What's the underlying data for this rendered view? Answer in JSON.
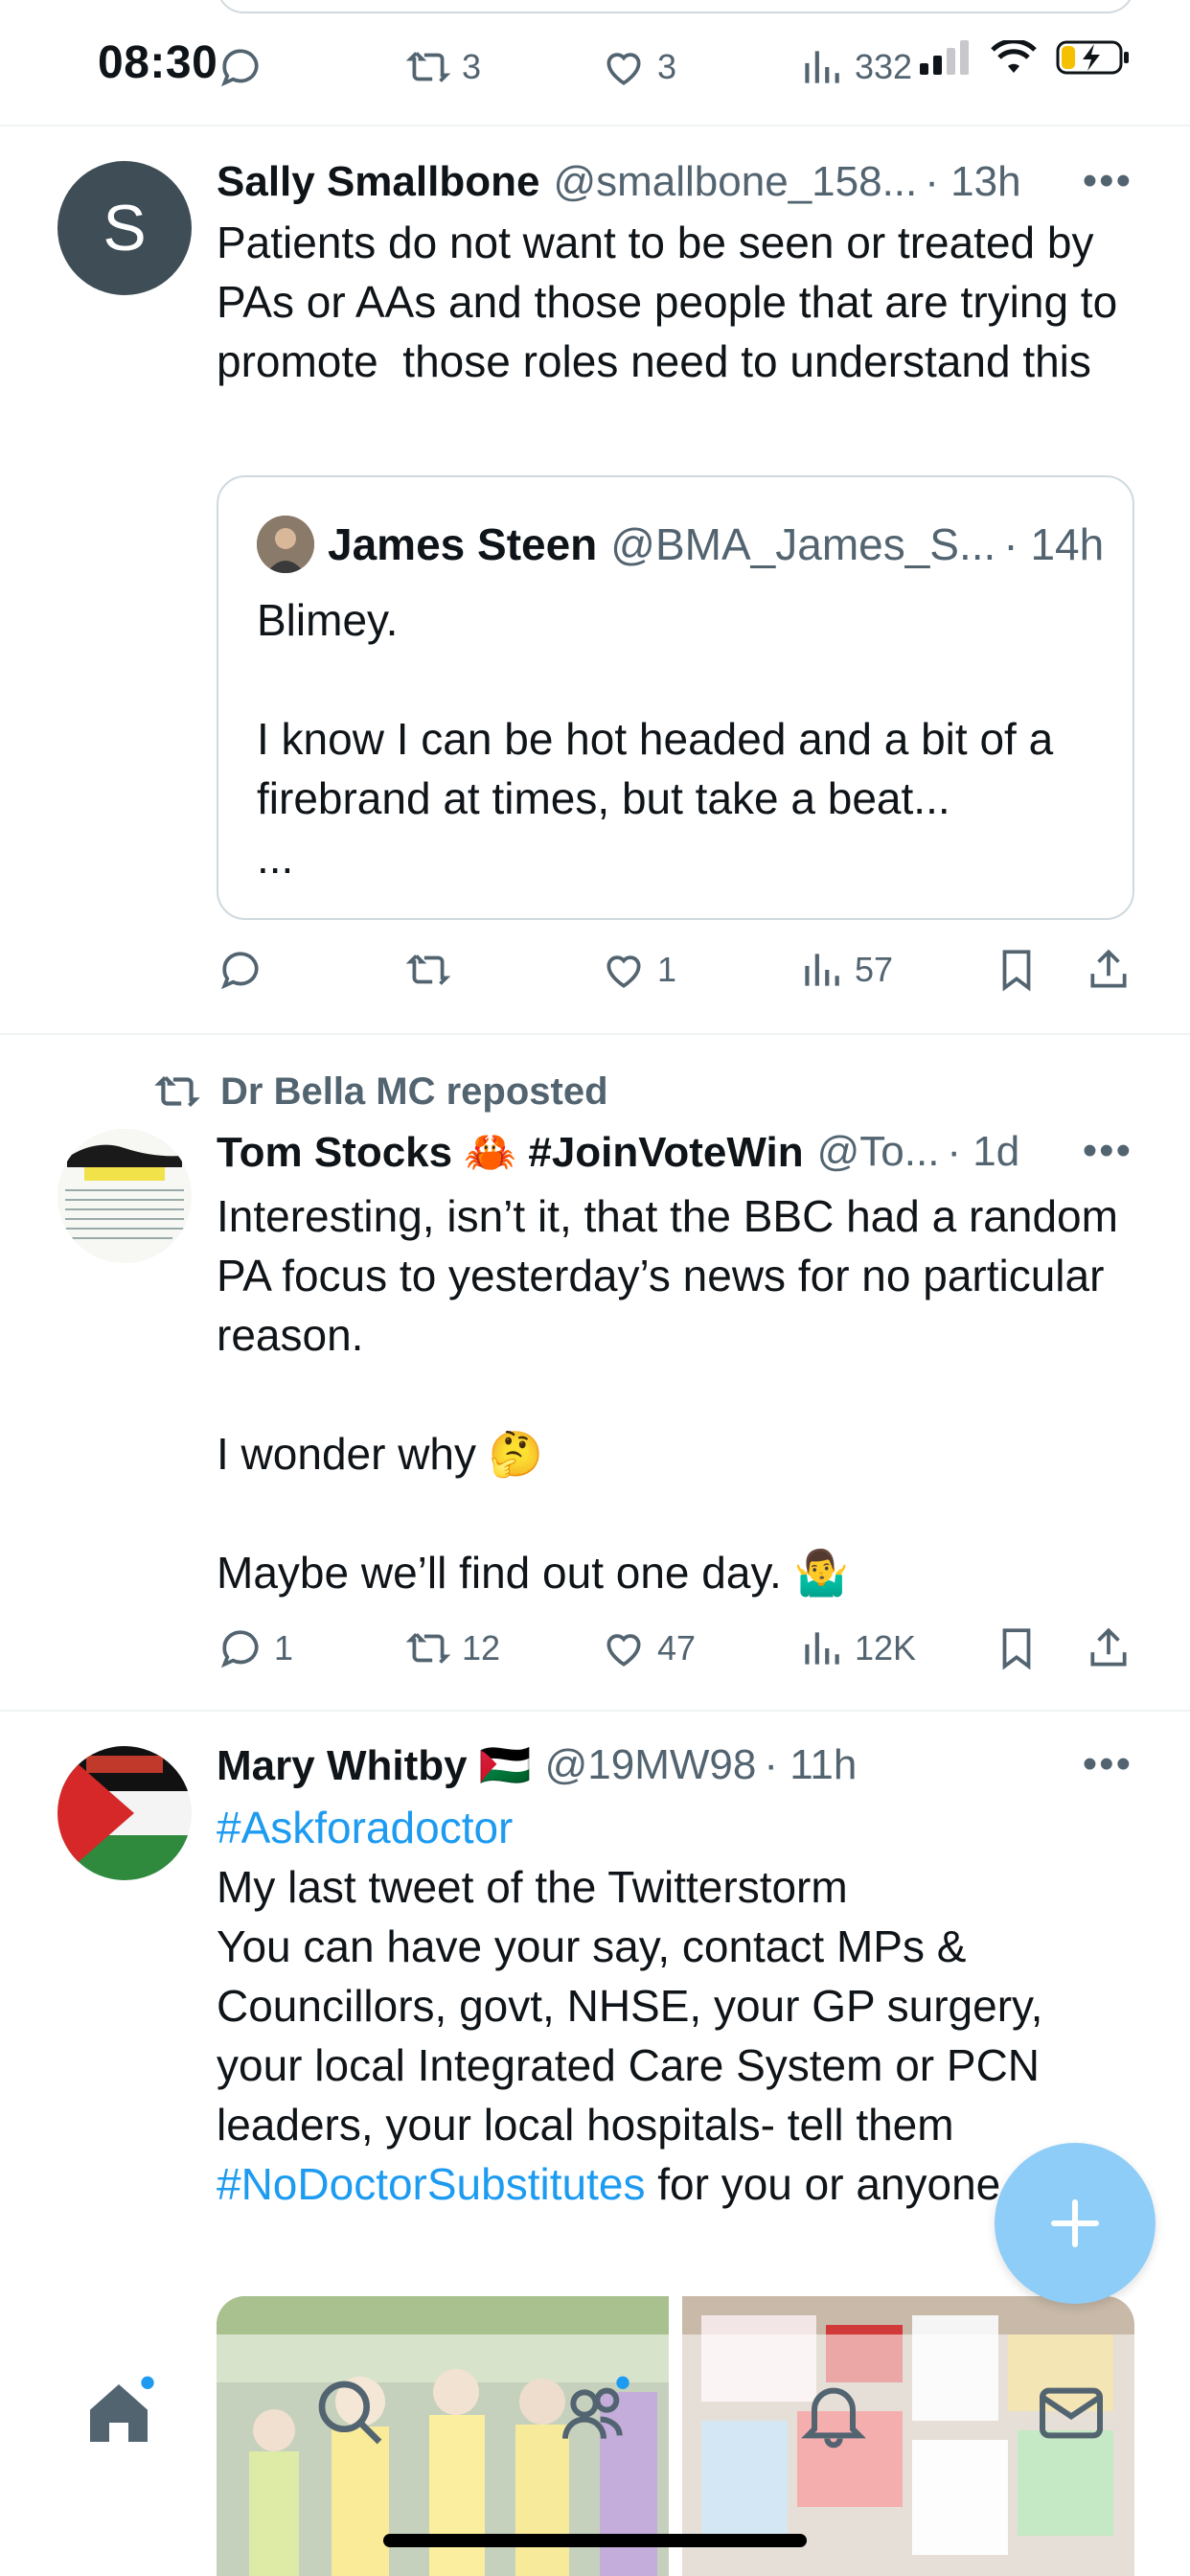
{
  "status_bar": {
    "time": "08:30"
  },
  "prev_post": {
    "reply_count": "",
    "repost_count": "3",
    "like_count": "3",
    "view_count": "332"
  },
  "post1": {
    "avatar_initial": "S",
    "avatar_color": "#3e4d56",
    "name": "Sally Smallbone",
    "handle": "@smallbone_158...",
    "time": "· 13h",
    "text": "Patients do not want to be seen or treated by PAs or AAs and those people that are trying to promote  those roles need to understand this",
    "quote": {
      "name": "James Steen",
      "handle": "@BMA_James_S...",
      "time": "· 14h",
      "text": "Blimey.\n\nI know I can be hot headed and a bit of a firebrand at times, but take a beat...\n..."
    },
    "actions": {
      "reply_count": "",
      "repost_count": "",
      "like_count": "1",
      "view_count": "57"
    }
  },
  "post2": {
    "repost_label": "Dr Bella MC reposted",
    "name": "Tom Stocks 🦀 #JoinVoteWin",
    "handle": "@To...",
    "time": "· 1d",
    "text": "Interesting, isn’t it, that the BBC had a random PA focus to yesterday’s news for no particular reason.\n\nI wonder why 🤔\n\nMaybe we’ll find out one day. 🤷‍♂️",
    "actions": {
      "reply_count": "1",
      "repost_count": "12",
      "like_count": "47",
      "view_count": "12K"
    }
  },
  "post3": {
    "name": "Mary Whitby 🇵🇸",
    "handle": "@19MW98",
    "time": "· 11h",
    "hashtag1": "#Askforadoctor",
    "text_a": "My last tweet of the Twitterstorm\nYou can have your say, contact MPs & Councillors, govt, NHSE, your GP surgery, your local Integrated Care System or PCN leaders, your local hospitals- tell them ",
    "hashtag2": "#NoDoctorSubstitutes",
    "text_b": " for you or anyone else"
  },
  "colors": {
    "accent": "#1d9bf0",
    "fab": "#8ecdf7",
    "muted": "#536471"
  },
  "icons": [
    "reply-icon",
    "repost-icon",
    "like-icon",
    "views-icon",
    "bookmark-icon",
    "share-icon",
    "home-icon",
    "search-icon",
    "communities-icon",
    "notifications-icon",
    "messages-icon",
    "compose-icon"
  ]
}
